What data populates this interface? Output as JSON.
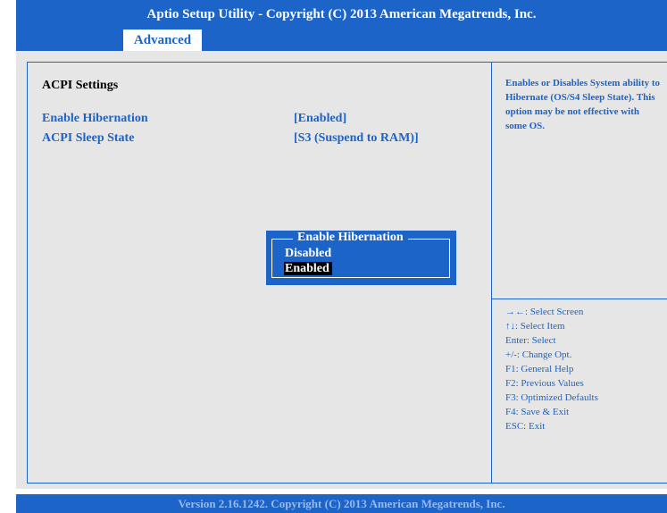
{
  "header": {
    "title": "Aptio Setup Utility - Copyright (C) 2013 American Megatrends, Inc."
  },
  "tabs": [
    {
      "label": "Advanced"
    }
  ],
  "main": {
    "section_title": "ACPI Settings",
    "settings": [
      {
        "label": "Enable Hibernation",
        "value": "[Enabled]"
      },
      {
        "label": "ACPI Sleep State",
        "value": "[S3 (Suspend to RAM)]"
      }
    ]
  },
  "popup": {
    "title": "Enable Hibernation",
    "options": [
      "Disabled",
      "Enabled"
    ],
    "selected": "Enabled"
  },
  "help": {
    "description": "Enables or Disables System ability to Hibernate (OS/S4 Sleep State). This option may be not effective with some OS."
  },
  "keys": [
    "→←: Select Screen",
    "↑↓: Select Item",
    "Enter: Select",
    "+/-: Change Opt.",
    "F1: General Help",
    "F2: Previous Values",
    "F3: Optimized Defaults",
    "F4: Save & Exit",
    "ESC: Exit"
  ],
  "footer": {
    "version": "Version 2.16.1242. Copyright (C) 2013 American Megatrends, Inc."
  },
  "colors": {
    "accent": "#1c64c8",
    "background": "#e6e6e6",
    "text": "#000000",
    "footer_text": "#98b8e8"
  }
}
